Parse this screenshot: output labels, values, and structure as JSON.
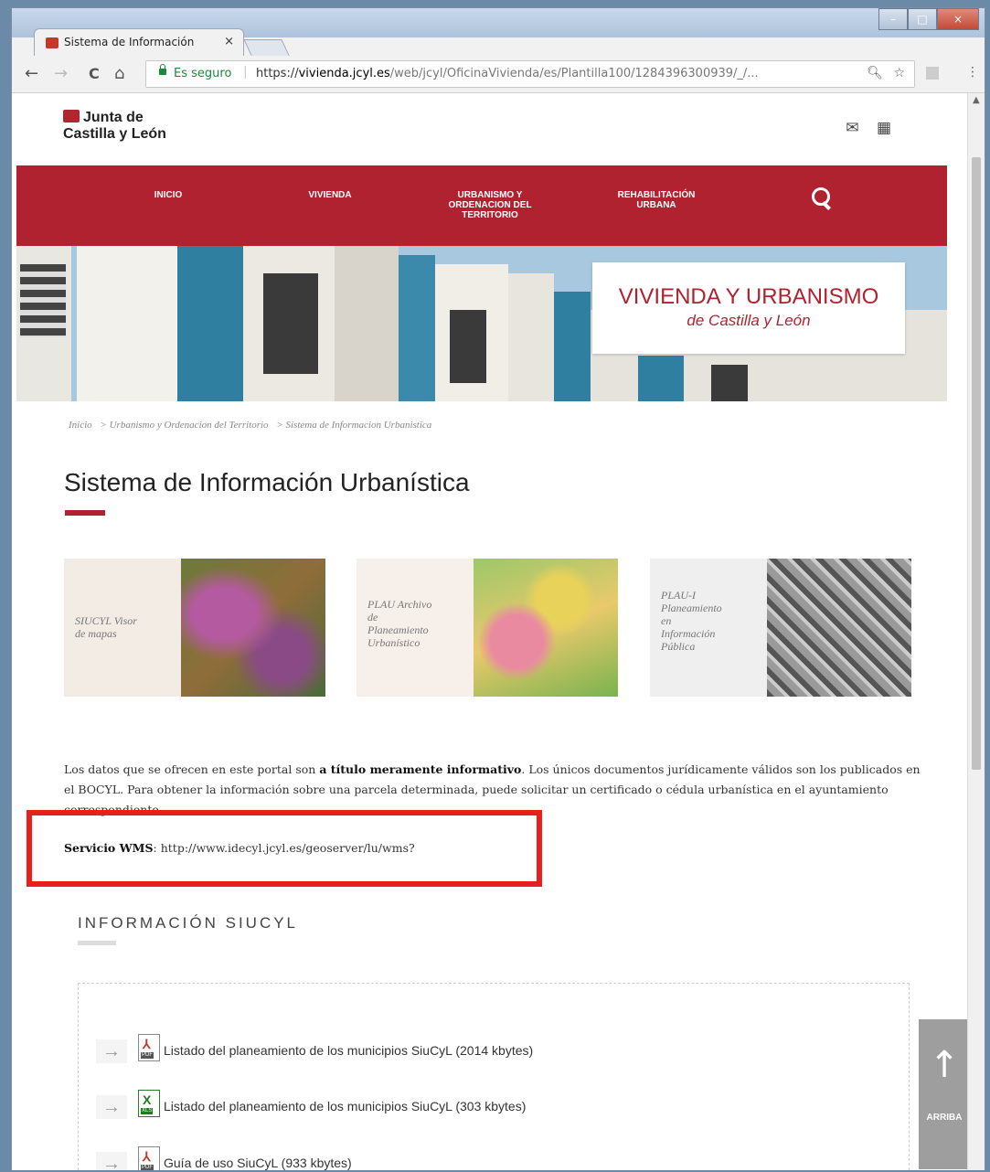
{
  "browser": {
    "tab_title": "Sistema de Información",
    "tab_close": "×",
    "window_buttons": [
      "–",
      "□",
      "×"
    ],
    "nav": {
      "back": "←",
      "forward": "→",
      "reload": "C",
      "home": "⌂"
    },
    "secure_label": "Es seguro",
    "url_scheme": "https://",
    "url_host": "vivienda.jcyl.es",
    "url_path": "/web/jcyl/OficinaVivienda/es/Plantilla100/1284396300939/_/...",
    "omnibox_icons": [
      "zoom-icon",
      "star-icon"
    ],
    "extension_icons": [
      "extension-icon",
      "menu-icon"
    ]
  },
  "header": {
    "logo_line1": "Junta de",
    "logo_line2": "Castilla y León",
    "icons": [
      "mail-icon",
      "grid-icon"
    ]
  },
  "nav": {
    "items": [
      {
        "label": "INICIO"
      },
      {
        "label": "VIVIENDA"
      },
      {
        "label": "URBANISMO Y\nORDENACION DEL\nTERRITORIO"
      },
      {
        "label": "REHABILITACIÓN\nURBANA"
      }
    ]
  },
  "hero": {
    "title": "VIVIENDA Y URBANISMO",
    "subtitle": "de Castilla y León"
  },
  "breadcrumb": [
    "Inicio",
    "> Urbanismo y Ordenacion del Territorio",
    "> Sistema de Informacion Urbanistica"
  ],
  "page_title": "Sistema de Información Urbanística",
  "tiles": [
    {
      "label": [
        "SIUCYL Visor",
        "de mapas"
      ]
    },
    {
      "label": [
        "PLAU Archivo",
        "de",
        "Planeamiento",
        "Urbanístico"
      ]
    },
    {
      "label": [
        "PLAU-I",
        "Planeamiento",
        "en",
        "Información",
        "Pública"
      ]
    }
  ],
  "paragraph": {
    "pre": "Los datos que se ofrecen en este portal son ",
    "bold": "a título meramente informativo",
    "post": ". Los únicos documentos jurídicamente válidos son los publicados en el BOCYL. Para obtener la información sobre una parcela determinada, puede solicitar un certificado o cédula urbanística en el ayuntamiento correspondiente."
  },
  "wms": {
    "label": "Servicio WMS",
    "value": ": http://www.idecyl.jcyl.es/geoserver/lu/wms?"
  },
  "section_title": "INFORMACIÓN SIUCYL",
  "documents": [
    {
      "type": "pdf",
      "text": "Listado del planeamiento de los municipios SiuCyL (2014 kbytes)"
    },
    {
      "type": "xls",
      "text": "Listado del planeamiento de los municipios SiuCyL (303 kbytes)"
    },
    {
      "type": "pdf",
      "text": "Guía de uso SiuCyL (933 kbytes)"
    }
  ],
  "back_to_top": "ARRIBA",
  "colors": {
    "brand_red": "#b0222f",
    "highlight_red": "#e8201b"
  }
}
